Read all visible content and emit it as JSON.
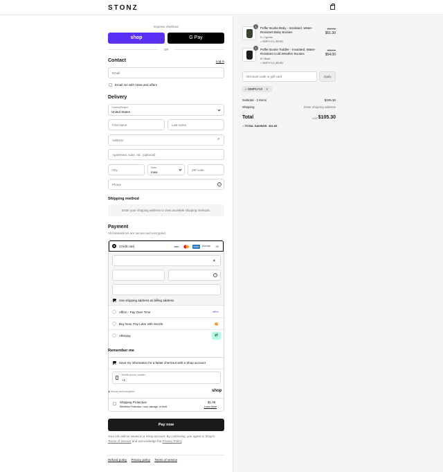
{
  "header": {
    "logo": "STONZ",
    "cart_icon": "bag-icon"
  },
  "express": {
    "title": "Express checkout",
    "shop_label": "shop",
    "gpay_label": "G Pay",
    "or_label": "OR"
  },
  "contact": {
    "heading": "Contact",
    "login_link": "Log in",
    "email_placeholder": "Email",
    "news_label": "Email me with news and offers"
  },
  "delivery": {
    "heading": "Delivery",
    "country_label": "Country/Region",
    "country_value": "United States",
    "first_name": "First name",
    "last_name": "Last name",
    "address": "Address",
    "apartment": "Apartment, suite, etc. (optional)",
    "city": "City",
    "state_label": "State",
    "state_value": "Iowa",
    "zip": "ZIP code",
    "phone": "Phone"
  },
  "shipping_method": {
    "heading": "Shipping method",
    "note": "Enter your shipping address to view available shipping methods."
  },
  "payment": {
    "heading": "Payment",
    "subtitle": "All transactions are secure and encrypted.",
    "credit_card_label": "Credit card",
    "more_cards": "+5",
    "card_logos": [
      "VISA",
      "MC",
      "AMEX",
      "DISCOVER"
    ],
    "billing_label": "Use shipping address as billing address",
    "options": [
      {
        "label": "Affirm - Pay Over Time",
        "logo": "affirm"
      },
      {
        "label": "Buy Now, Pay Later with Sezzle",
        "logo": "sezzle"
      },
      {
        "label": "Afterpay",
        "logo": "afterpay"
      }
    ]
  },
  "remember": {
    "heading": "Remember me",
    "save_label": "Save my information for a faster checkout with a Shop account",
    "phone_label": "Mobile phone number",
    "phone_value": "+1",
    "secure_label": "Secure and encrypted",
    "shop_label": "shop"
  },
  "protection": {
    "title": "Shipping Protection",
    "subtitle": "Effortless Protection: Loss, damage, or theft",
    "price": "$1.09",
    "learn_more": "Learn More"
  },
  "pay_button": "Pay now",
  "legal": {
    "text1": "Your info will be saved to a Shop account. By continuing, you agree to Shop's",
    "terms": "Terms of Service",
    "text2": "and acknowledge the",
    "privacy": "Privacy Policy",
    "period": "."
  },
  "footer": {
    "refund": "Refund policy",
    "privacy": "Privacy policy",
    "terms": "Terms of service"
  },
  "summary": {
    "items": [
      {
        "qty": "1",
        "name": "Puffer Bootie Baby - Insulated, Water-Resistant Baby Booties",
        "variant": "S / Cypress",
        "discount": "SIMPLY10 (-$5.65)",
        "old_price": "$56.50",
        "price": "$51.30"
      },
      {
        "qty": "1",
        "name": "Puffer Bootie Toddler - Insulated, Water-Resistant Cold Weather Booties",
        "variant": "M / Black",
        "discount": "SIMPLY10 (-$5.95)",
        "old_price": "$59.50",
        "price": "$54.00"
      }
    ],
    "discount_placeholder": "Discount code or gift card",
    "apply": "Apply",
    "applied_code": "SIMPLY10",
    "subtotal_label": "Subtotal · 2 items",
    "subtotal_value": "$105.30",
    "shipping_label": "Shipping",
    "shipping_value": "Enter shipping address",
    "total_label": "Total",
    "currency": "USD",
    "total_value": "$105.30",
    "savings_label": "TOTAL SAVINGS",
    "savings_value": "$11.69"
  }
}
